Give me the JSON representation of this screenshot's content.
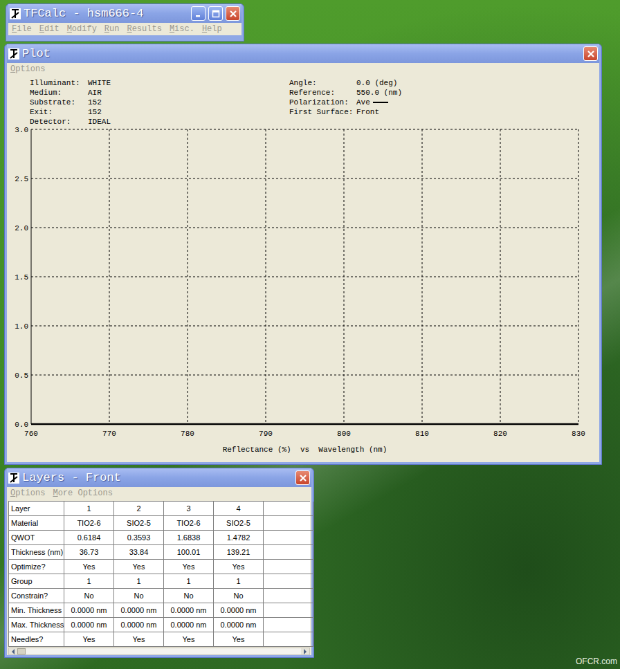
{
  "desktop": {
    "watermark": "OFCR.com"
  },
  "main_window": {
    "title": "TFCalc - hsm666-4",
    "menu": [
      {
        "label": "File",
        "disabled": true
      },
      {
        "label": "Edit",
        "disabled": true
      },
      {
        "label": "Modify",
        "disabled": true
      },
      {
        "label": "Run",
        "disabled": true
      },
      {
        "label": "Results",
        "disabled": true
      },
      {
        "label": "Misc.",
        "disabled": true
      },
      {
        "label": "Help",
        "disabled": true
      }
    ]
  },
  "plot_window": {
    "title": "Plot",
    "menu": [
      {
        "label": "Options",
        "disabled": true
      }
    ],
    "info_left": [
      {
        "label": "Illuminant:",
        "value": "WHITE",
        "legend": false
      },
      {
        "label": "Medium:",
        "value": "AIR",
        "legend": false
      },
      {
        "label": "Substrate:",
        "value": "152",
        "legend": false
      },
      {
        "label": "Exit:",
        "value": "152",
        "legend": false
      },
      {
        "label": "Detector:",
        "value": "IDEAL",
        "legend": false
      }
    ],
    "info_right": [
      {
        "label": "Angle:",
        "value": "0.0 (deg)",
        "legend": false
      },
      {
        "label": "Reference:",
        "value": "550.0 (nm)",
        "legend": false
      },
      {
        "label": "Polarization:",
        "value": "Ave",
        "legend": true
      },
      {
        "label": "First Surface:",
        "value": "Front",
        "legend": false
      }
    ],
    "chart": {
      "y_ticks": [
        "0.0",
        "0.5",
        "1.0",
        "1.5",
        "2.0",
        "2.5",
        "3.0"
      ],
      "y_min": 0,
      "y_max": 3,
      "x_ticks": [
        "760",
        "770",
        "780",
        "790",
        "800",
        "810",
        "820",
        "830"
      ],
      "x_min": 760,
      "x_max": 830,
      "x_label": "Reflectance (%)  vs  Wavelength (nm)",
      "series": [
        {
          "name": "Ave",
          "color": "#000000",
          "x": [
            760,
            770,
            780,
            790,
            800,
            810,
            820,
            830
          ],
          "values": [
            0,
            0,
            0,
            0,
            0,
            0,
            0,
            0
          ]
        }
      ]
    }
  },
  "layers_window": {
    "title": "Layers - Front",
    "menu": [
      {
        "label": "Options",
        "disabled": true
      },
      {
        "label": "More Options",
        "disabled": true
      }
    ],
    "rows": [
      {
        "label": "Layer",
        "cells": [
          "1",
          "2",
          "3",
          "4",
          ""
        ]
      },
      {
        "label": "Material",
        "cells": [
          "TIO2-6",
          "SIO2-5",
          "TIO2-6",
          "SIO2-5",
          ""
        ]
      },
      {
        "label": "QWOT",
        "cells": [
          "0.6184",
          "0.3593",
          "1.6838",
          "1.4782",
          ""
        ]
      },
      {
        "label": "Thickness (nm)",
        "cells": [
          "36.73",
          "33.84",
          "100.01",
          "139.21",
          ""
        ]
      },
      {
        "label": "Optimize?",
        "cells": [
          "Yes",
          "Yes",
          "Yes",
          "Yes",
          ""
        ]
      },
      {
        "label": "Group",
        "cells": [
          "1",
          "1",
          "1",
          "1",
          ""
        ]
      },
      {
        "label": "Constrain?",
        "cells": [
          "No",
          "No",
          "No",
          "No",
          ""
        ]
      },
      {
        "label": "Min. Thickness",
        "cells": [
          "0.0000 nm",
          "0.0000 nm",
          "0.0000 nm",
          "0.0000 nm",
          ""
        ]
      },
      {
        "label": "Max. Thickness",
        "cells": [
          "0.0000 nm",
          "0.0000 nm",
          "0.0000 nm",
          "0.0000 nm",
          ""
        ]
      },
      {
        "label": "Needles?",
        "cells": [
          "Yes",
          "Yes",
          "Yes",
          "Yes",
          ""
        ]
      }
    ]
  }
}
